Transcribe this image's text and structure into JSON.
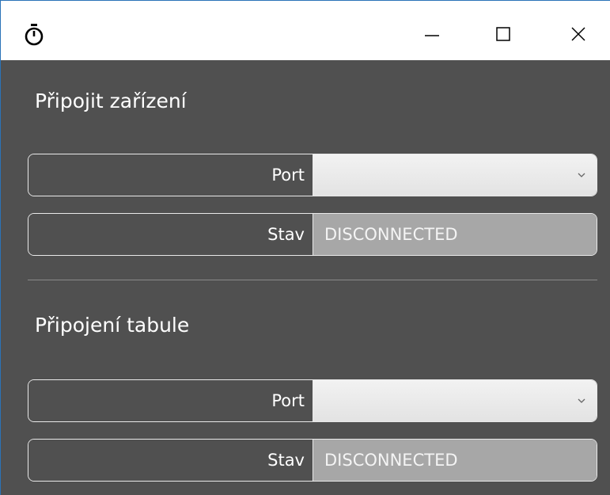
{
  "window": {
    "icon": "stopwatch-icon",
    "controls": {
      "minimize": "minimize-icon",
      "maximize": "maximize-icon",
      "close": "close-icon"
    }
  },
  "sections": [
    {
      "title": "Připojit zařízení",
      "port_label": "Port",
      "port_value": "",
      "status_label": "Stav",
      "status_value": "DISCONNECTED"
    },
    {
      "title": "Připojení tabule",
      "port_label": "Port",
      "port_value": "",
      "status_label": "Stav",
      "status_value": "DISCONNECTED"
    }
  ],
  "colors": {
    "background": "#505050",
    "status_background": "#a7a7a7",
    "select_background": "#ececec",
    "border": "#e9e9e9"
  }
}
